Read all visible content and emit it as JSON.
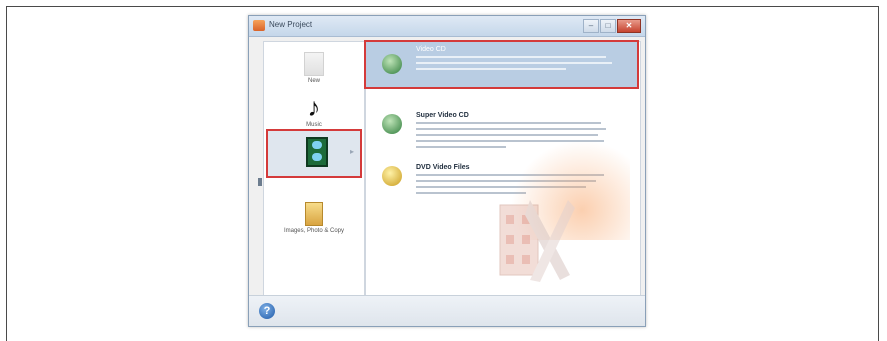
{
  "window": {
    "title": "New Project",
    "controls": {
      "minimize": "–",
      "maximize": "□",
      "close": "✕"
    }
  },
  "sidebar": {
    "items": [
      {
        "label": "New",
        "icon": "new-document-icon"
      },
      {
        "label": "Music",
        "icon": "music-note-icon"
      },
      {
        "label": "Video",
        "icon": "video-film-icon",
        "selected": true
      },
      {
        "label": "Images, Photo & Copy",
        "icon": "photo-icon"
      }
    ]
  },
  "options": [
    {
      "title": "Video CD",
      "icon": "video-cd-disc-icon",
      "selected": true
    },
    {
      "title": "Super Video CD",
      "icon": "super-video-cd-disc-icon"
    },
    {
      "title": "DVD Video Files",
      "icon": "dvd-disc-icon"
    }
  ],
  "help": {
    "glyph": "?"
  },
  "colors": {
    "selection_border": "#d43a3a",
    "selected_option_bg": "#b9cde3",
    "titlebar": "#c5d7ea"
  }
}
